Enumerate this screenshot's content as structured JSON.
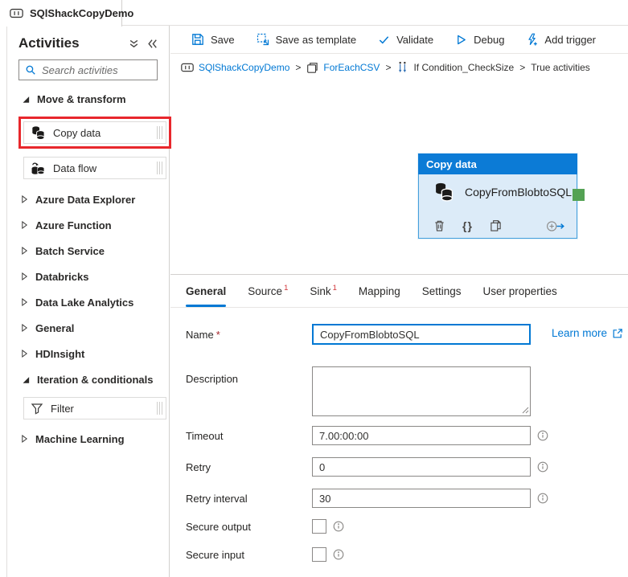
{
  "window": {
    "tab_title": "SQlShackCopyDemo"
  },
  "sidebar": {
    "title": "Activities",
    "search_placeholder": "Search activities",
    "groups": [
      {
        "label": "Move & transform",
        "expanded": true
      },
      {
        "label": "Azure Data Explorer",
        "expanded": false
      },
      {
        "label": "Azure Function",
        "expanded": false
      },
      {
        "label": "Batch Service",
        "expanded": false
      },
      {
        "label": "Databricks",
        "expanded": false
      },
      {
        "label": "Data Lake Analytics",
        "expanded": false
      },
      {
        "label": "General",
        "expanded": false
      },
      {
        "label": "HDInsight",
        "expanded": false
      },
      {
        "label": "Iteration & conditionals",
        "expanded": true
      },
      {
        "label": "Machine Learning",
        "expanded": false
      }
    ],
    "move_transform_items": [
      {
        "label": "Copy data",
        "highlighted": true
      },
      {
        "label": "Data flow",
        "highlighted": false
      }
    ],
    "iteration_items": [
      {
        "label": "Filter"
      }
    ]
  },
  "toolbar": {
    "buttons": [
      {
        "label": "Save"
      },
      {
        "label": "Save as template"
      },
      {
        "label": "Validate"
      },
      {
        "label": "Debug"
      },
      {
        "label": "Add trigger"
      }
    ]
  },
  "breadcrumb": {
    "separator": ">",
    "items": [
      {
        "label": "SQlShackCopyDemo",
        "link": true
      },
      {
        "label": "ForEachCSV",
        "link": true
      },
      {
        "label": "If Condition_CheckSize",
        "link": false
      },
      {
        "label": "True activities",
        "link": false
      }
    ]
  },
  "canvas": {
    "node": {
      "type_label": "Copy data",
      "name": "CopyFromBlobtoSQL",
      "braces_glyph": "{}"
    }
  },
  "panel": {
    "tabs": [
      {
        "label": "General",
        "active": true,
        "badge": ""
      },
      {
        "label": "Source",
        "active": false,
        "badge": "1"
      },
      {
        "label": "Sink",
        "active": false,
        "badge": "1"
      },
      {
        "label": "Mapping",
        "active": false,
        "badge": ""
      },
      {
        "label": "Settings",
        "active": false,
        "badge": ""
      },
      {
        "label": "User properties",
        "active": false,
        "badge": ""
      }
    ],
    "fields": {
      "name": {
        "label": "Name",
        "required_mark": "*",
        "value": "CopyFromBlobtoSQL",
        "learn_more": "Learn more"
      },
      "description": {
        "label": "Description",
        "value": ""
      },
      "timeout": {
        "label": "Timeout",
        "value": "7.00:00:00"
      },
      "retry": {
        "label": "Retry",
        "value": "0"
      },
      "retry_interval": {
        "label": "Retry interval",
        "value": "30"
      },
      "secure_output": {
        "label": "Secure output",
        "checked": false
      },
      "secure_input": {
        "label": "Secure input",
        "checked": false
      }
    }
  },
  "colors": {
    "accent": "#0078d4",
    "node_header": "#0c7bd6",
    "node_body": "#dcebf8",
    "node_border": "#45a0dc",
    "highlight_red": "#e8272c",
    "badge_red": "#d13438",
    "connector_green": "#54a254"
  }
}
